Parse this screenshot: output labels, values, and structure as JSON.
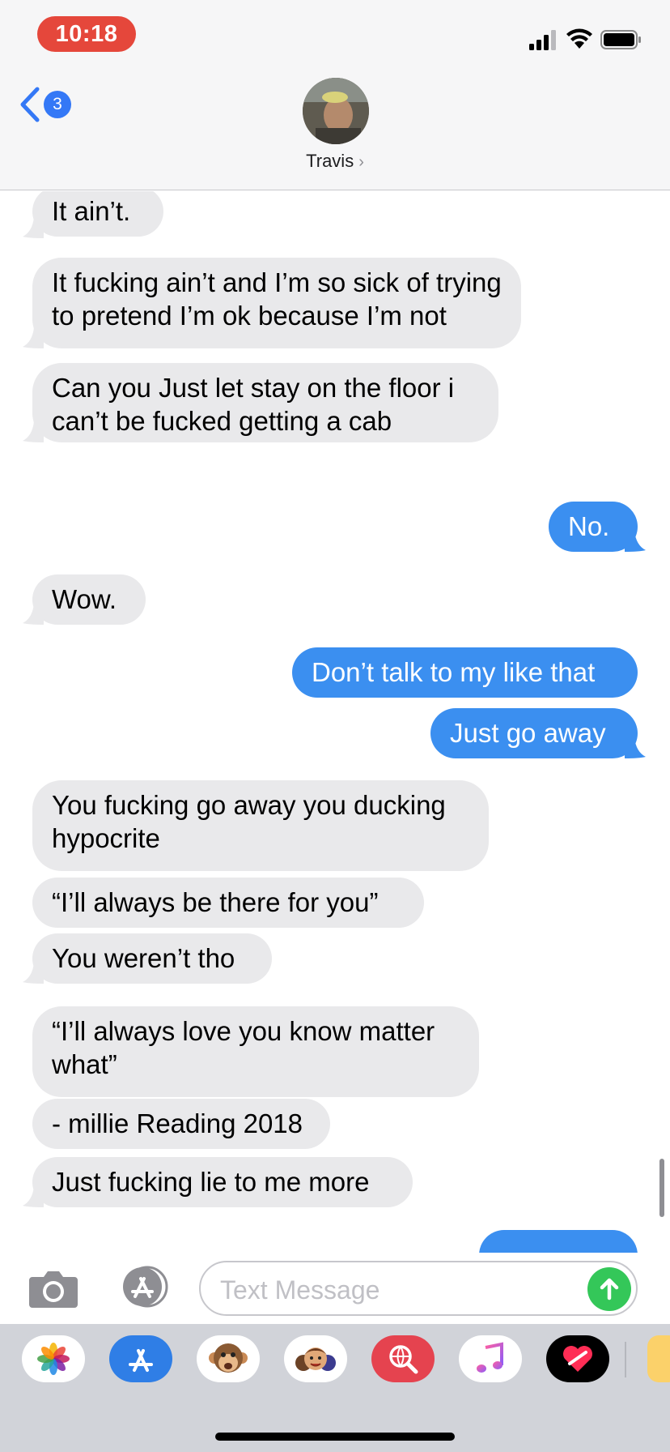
{
  "status_bar": {
    "time": "10:18"
  },
  "header": {
    "back_badge": "3",
    "contact_name": "Travis",
    "contact_chevron": "›"
  },
  "messages": [
    {
      "from": "them",
      "text": "It ain’t."
    },
    {
      "from": "them",
      "text": "It fucking ain’t and I’m so sick of trying to pretend I’m ok because I’m not"
    },
    {
      "from": "them",
      "text": "Can you Just let stay on the floor i can’t be fucked getting a cab"
    },
    {
      "from": "me",
      "text": "No."
    },
    {
      "from": "them",
      "text": "Wow."
    },
    {
      "from": "me",
      "text": "Don’t talk to my like that"
    },
    {
      "from": "me",
      "text": "Just go away"
    },
    {
      "from": "them",
      "text": "You fucking go away you ducking hypocrite"
    },
    {
      "from": "them",
      "text": "“I’ll always be there for you”"
    },
    {
      "from": "them",
      "text": "You weren’t tho"
    },
    {
      "from": "them",
      "text": "“I’ll always love you know matter what”"
    },
    {
      "from": "them",
      "text": "- millie Reading 2018"
    },
    {
      "from": "them",
      "text": "Just fucking lie to me more"
    }
  ],
  "input_bar": {
    "placeholder": "Text Message"
  },
  "app_drawer": {
    "apps": [
      "photos-app",
      "app-store",
      "animoji",
      "memoji",
      "web-images-search",
      "music",
      "digital-touch",
      "stickers"
    ]
  },
  "colors": {
    "incoming_bubble": "#e9e9eb",
    "outgoing_bubble": "#3b8ff0",
    "send_button": "#34c759",
    "badge": "#3478f6",
    "time_pill": "#e5473b"
  }
}
